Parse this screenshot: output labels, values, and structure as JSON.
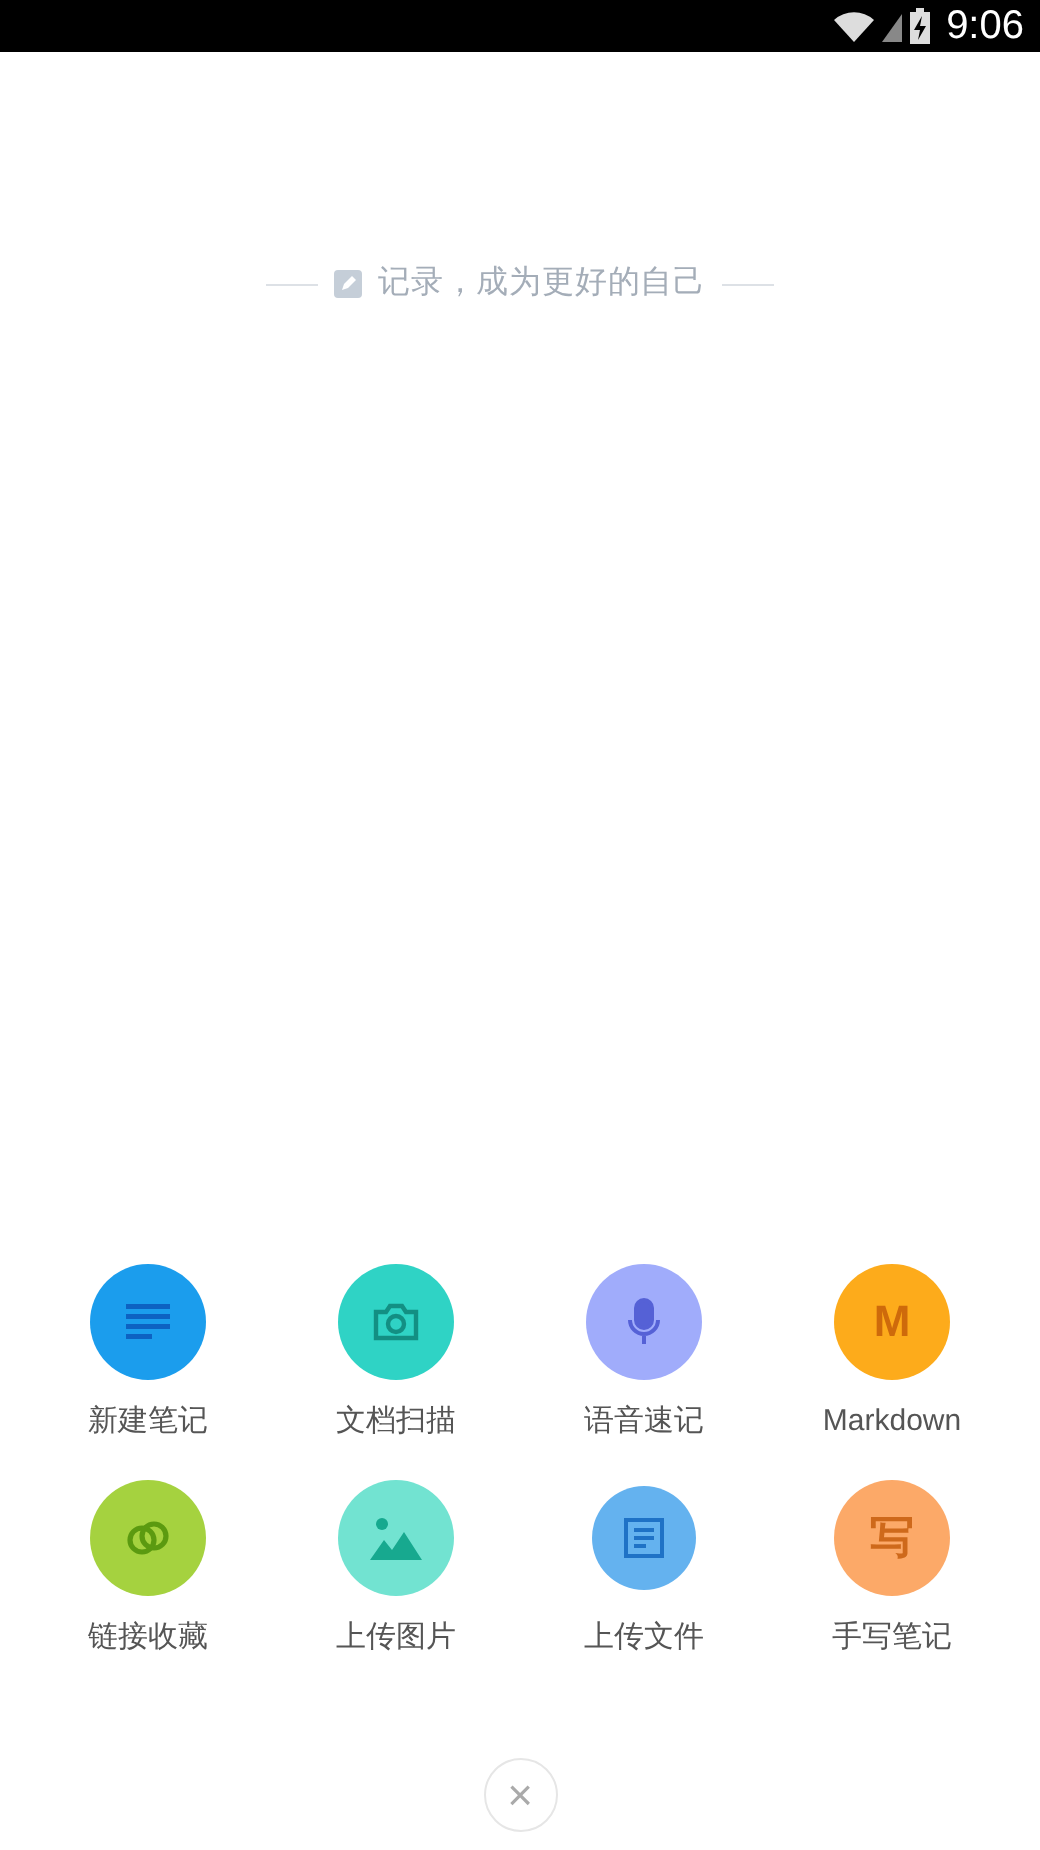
{
  "status_bar": {
    "time": "9:06"
  },
  "tagline": "记录，成为更好的自己",
  "actions": [
    {
      "label": "新建笔记",
      "kind": "lines",
      "color": "#1b9ded"
    },
    {
      "label": "文档扫描",
      "kind": "camera",
      "color": "#2fd3c5"
    },
    {
      "label": "语音速记",
      "kind": "mic",
      "color": "#a0acfb"
    },
    {
      "label": "Markdown",
      "kind": "glyph",
      "glyph": "M",
      "color": "#fdab1b"
    },
    {
      "label": "链接收藏",
      "kind": "link",
      "color": "#a5d23f"
    },
    {
      "label": "上传图片",
      "kind": "image",
      "color": "#72e3d1"
    },
    {
      "label": "上传文件",
      "kind": "file",
      "color": "#64b2ef",
      "small": true
    },
    {
      "label": "手写笔记",
      "kind": "glyph",
      "glyph": "写",
      "color": "#fca968"
    }
  ],
  "close_button": "×"
}
